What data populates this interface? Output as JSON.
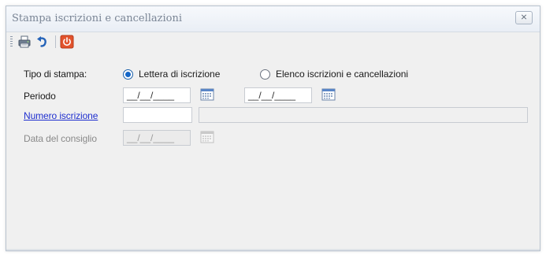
{
  "window": {
    "title": "Stampa iscrizioni e cancellazioni",
    "close_symbol": "⨯"
  },
  "toolbar": {
    "items": [
      {
        "name": "print-icon",
        "label": "Stampa"
      },
      {
        "name": "undo-icon",
        "label": "Annulla"
      },
      {
        "name": "power-icon",
        "label": "Esci"
      }
    ]
  },
  "form": {
    "tipo_stampa": {
      "label": "Tipo di stampa:",
      "options": [
        {
          "label": "Lettera di iscrizione",
          "checked": true
        },
        {
          "label": "Elenco iscrizioni e cancellazioni",
          "checked": false
        }
      ]
    },
    "periodo": {
      "label": "Periodo",
      "from_value": "__/__/____",
      "to_value": "__/__/____"
    },
    "numero_iscrizione": {
      "label": "Numero iscrizione",
      "value": "",
      "description": ""
    },
    "data_consiglio": {
      "label": "Data del consiglio",
      "value": "__/__/____",
      "enabled": false
    }
  },
  "colors": {
    "link": "#1f2fcf",
    "radio_selected": "#1467c8",
    "window_bg": "#f0f0f0",
    "title_text": "#7a8595"
  }
}
